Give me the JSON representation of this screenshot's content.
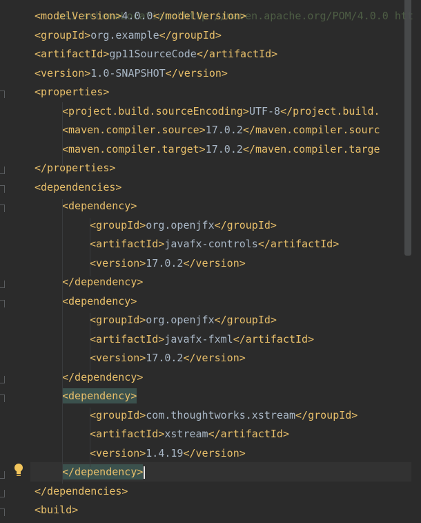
{
  "editor": {
    "top_partial": "xsi:schemaLocation=\"http://maven.apache.org/POM/4.0.0 htt",
    "lines": [
      {
        "indent": 0,
        "open": "<modelVersion>",
        "text": "4.0.0",
        "close": "</modelVersion>"
      },
      {
        "indent": 0,
        "open": "<groupId>",
        "text": "org.example",
        "close": "</groupId>"
      },
      {
        "indent": 0,
        "open": "<artifactId>",
        "text": "gp11SourceCode",
        "close": "</artifactId>"
      },
      {
        "indent": 0,
        "open": "<version>",
        "text": "1.0-SNAPSHOT",
        "close": "</version>"
      },
      {
        "indent": 0,
        "open": "<properties>",
        "text": "",
        "close": ""
      },
      {
        "indent": 1,
        "open": "<project.build.sourceEncoding>",
        "text": "UTF-8",
        "close": "</project.build."
      },
      {
        "indent": 1,
        "open": "<maven.compiler.source>",
        "text": "17.0.2",
        "close": "</maven.compiler.sourc"
      },
      {
        "indent": 1,
        "open": "<maven.compiler.target>",
        "text": "17.0.2",
        "close": "</maven.compiler.targe"
      },
      {
        "indent": 0,
        "open": "</properties>",
        "text": "",
        "close": ""
      },
      {
        "indent": 0,
        "open": "<dependencies>",
        "text": "",
        "close": ""
      },
      {
        "indent": 1,
        "open": "<dependency>",
        "text": "",
        "close": ""
      },
      {
        "indent": 2,
        "open": "<groupId>",
        "text": "org.openjfx",
        "close": "</groupId>"
      },
      {
        "indent": 2,
        "open": "<artifactId>",
        "text": "javafx-controls",
        "close": "</artifactId>"
      },
      {
        "indent": 2,
        "open": "<version>",
        "text": "17.0.2",
        "close": "</version>"
      },
      {
        "indent": 1,
        "open": "</dependency>",
        "text": "",
        "close": ""
      },
      {
        "indent": 1,
        "open": "<dependency>",
        "text": "",
        "close": ""
      },
      {
        "indent": 2,
        "open": "<groupId>",
        "text": "org.openjfx",
        "close": "</groupId>"
      },
      {
        "indent": 2,
        "open": "<artifactId>",
        "text": "javafx-fxml",
        "close": "</artifactId>"
      },
      {
        "indent": 2,
        "open": "<version>",
        "text": "17.0.2",
        "close": "</version>"
      },
      {
        "indent": 1,
        "open": "</dependency>",
        "text": "",
        "close": ""
      },
      {
        "indent": 1,
        "open": "<dependency>",
        "text": "",
        "close": "",
        "highlight": true
      },
      {
        "indent": 2,
        "open": "<groupId>",
        "text": "com.thoughtworks.xstream",
        "close": "</groupId>"
      },
      {
        "indent": 2,
        "open": "<artifactId>",
        "text": "xstream",
        "close": "</artifactId>"
      },
      {
        "indent": 2,
        "open": "<version>",
        "text": "1.4.19",
        "close": "</version>"
      },
      {
        "indent": 1,
        "open": "</dependency>",
        "text": "",
        "close": "",
        "highlight": true,
        "caret": true
      },
      {
        "indent": 0,
        "open": "</dependencies>",
        "text": "",
        "close": ""
      },
      {
        "indent": 0,
        "open": "<build>",
        "text": "",
        "close": ""
      }
    ]
  },
  "icons": {
    "intention": "lightbulb-icon"
  },
  "colors": {
    "background": "#2b2b2b",
    "tag": "#e8bf6a",
    "text": "#a9b7c6",
    "match_highlight": "#3b514d",
    "current_line": "#323232"
  }
}
